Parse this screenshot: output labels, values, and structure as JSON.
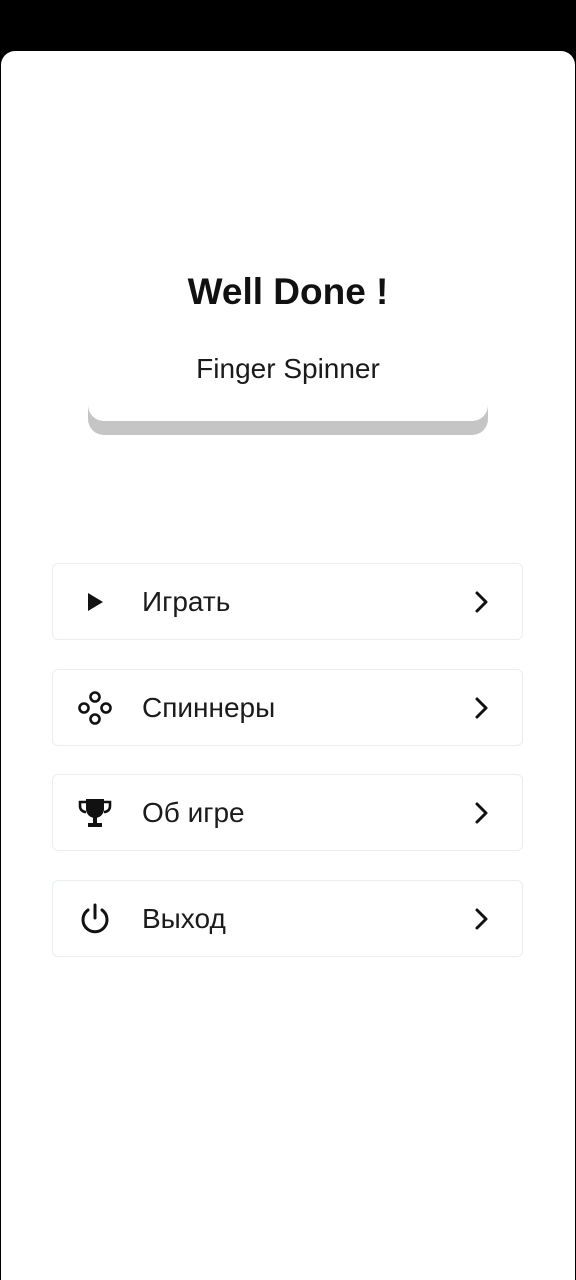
{
  "header": {
    "title": "Well Done !",
    "subtitle": "Finger Spinner"
  },
  "menu": {
    "items": [
      {
        "label": "Играть",
        "icon": "play-icon"
      },
      {
        "label": "Спиннеры",
        "icon": "spinner-icon"
      },
      {
        "label": "Об игре",
        "icon": "trophy-icon"
      },
      {
        "label": "Выход",
        "icon": "power-icon"
      }
    ]
  },
  "colors": {
    "background": "#ffffff",
    "text": "#111111",
    "button_border": "#e9eef0",
    "subtitle_shadow": "#c5c5c5"
  }
}
